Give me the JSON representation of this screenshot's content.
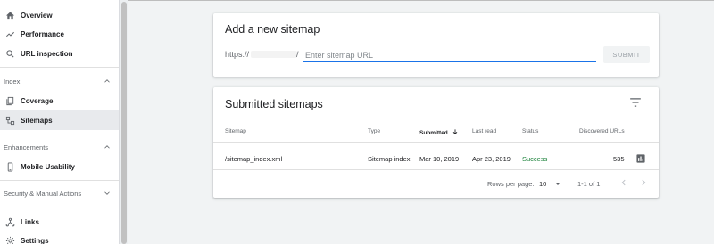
{
  "sidebar": {
    "items_top": [
      {
        "label": "Overview",
        "icon": "home-icon"
      },
      {
        "label": "Performance",
        "icon": "trending-icon"
      },
      {
        "label": "URL inspection",
        "icon": "search-icon"
      }
    ],
    "index_section": {
      "label": "Index"
    },
    "index_items": [
      {
        "label": "Coverage",
        "icon": "coverage-icon"
      },
      {
        "label": "Sitemaps",
        "icon": "sitemaps-icon",
        "active": true
      }
    ],
    "enhancements_section": {
      "label": "Enhancements"
    },
    "enhancements_items": [
      {
        "label": "Mobile Usability",
        "icon": "phone-icon"
      }
    ],
    "security_section": {
      "label": "Security & Manual Actions"
    },
    "bottom_items": [
      {
        "label": "Links",
        "icon": "links-icon"
      },
      {
        "label": "Settings",
        "icon": "settings-icon"
      }
    ]
  },
  "add_sitemap": {
    "title": "Add a new sitemap",
    "url_prefix": "https://",
    "url_prefix_end": "/",
    "input_placeholder": "Enter sitemap URL",
    "submit_label": "SUBMIT"
  },
  "submitted": {
    "title": "Submitted sitemaps",
    "columns": {
      "sitemap": "Sitemap",
      "type": "Type",
      "submitted": "Submitted",
      "last_read": "Last read",
      "status": "Status",
      "discovered": "Discovered URLs"
    },
    "rows": [
      {
        "sitemap": "/sitemap_index.xml",
        "type": "Sitemap index",
        "submitted": "Mar 10, 2019",
        "last_read": "Apr 23, 2019",
        "status": "Success",
        "discovered": "535"
      }
    ],
    "footer": {
      "rows_per_page_label": "Rows per page:",
      "rows_per_page_value": "10",
      "range": "1-1 of 1"
    }
  },
  "colors": {
    "accent": "#1a73e8",
    "success": "#188038",
    "active_nav": "#e8eaed"
  }
}
